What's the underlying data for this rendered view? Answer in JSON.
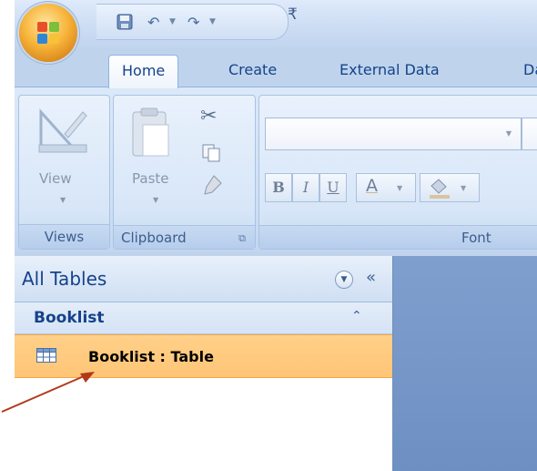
{
  "qat": {
    "save_icon": "save-icon",
    "undo_icon": "undo-icon",
    "redo_icon": "redo-icon",
    "customize_icon": "customize-qat-icon",
    "customize_glyph": "₹"
  },
  "tabs": [
    {
      "label": "Home",
      "active": true
    },
    {
      "label": "Create",
      "active": false
    },
    {
      "label": "External Data",
      "active": false
    },
    {
      "label": "Da",
      "active": false
    }
  ],
  "ribbon": {
    "groups": {
      "views": {
        "label": "Views",
        "view_button": "View"
      },
      "clipboard": {
        "label": "Clipboard",
        "paste_button": "Paste"
      },
      "font": {
        "label": "Font",
        "bold": "B",
        "italic": "I",
        "underline": "U",
        "font_color": "A"
      }
    }
  },
  "nav": {
    "title": "All Tables",
    "menu_glyph": "▼",
    "collapse_glyph": "«",
    "group": {
      "title": "Booklist",
      "chevron": "⌃"
    },
    "items": [
      {
        "label": "Booklist : Table",
        "selected": true
      }
    ]
  },
  "colors": {
    "accent": "#15428b",
    "selection": "#ffc576",
    "workspace": "#7f9fcf",
    "annotation_arrow": "#b03a1a"
  }
}
